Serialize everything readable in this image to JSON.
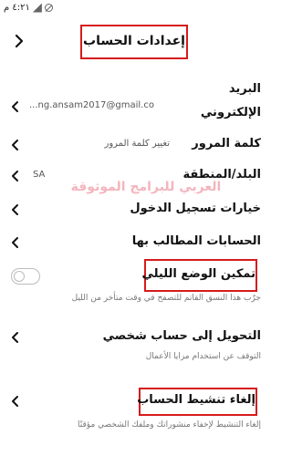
{
  "status_bar": {
    "time": "٤:٢١ م"
  },
  "header": {
    "title": "إعدادات الحساب"
  },
  "rows": {
    "email": {
      "label_line1": "البريد",
      "label_line2": "الإلكتروني",
      "value": "...ng.ansam2017@gmail.co"
    },
    "password": {
      "label": "كلمة المرور",
      "value": "تغيير كلمة المرور"
    },
    "country": {
      "label": "البلد/المنطقة",
      "value": "SA"
    },
    "login": {
      "label": "خيارات تسجيل الدخول"
    },
    "linked": {
      "label": "الحسابات المطالب بها"
    },
    "night": {
      "label": "تمكين الوضع الليلي",
      "desc": "جرّب هذا النسق القاتم للتصفح في وقت متأخر من الليل",
      "enabled": false
    },
    "personal": {
      "label": "التحويل إلى حساب شخصي",
      "desc": "التوقف عن استخدام مزايا الأعمال"
    },
    "deactivate": {
      "label": "إلغاء تنشيط الحساب",
      "desc": "إلغاء التنشيط لإخفاء منشوراتك وملفك الشخصي مؤقتًا"
    }
  },
  "watermark": "العربي للبرامج الموثوقة",
  "colors": {
    "highlight_border": "#d61b1b",
    "watermark": "#f2a9b2"
  }
}
